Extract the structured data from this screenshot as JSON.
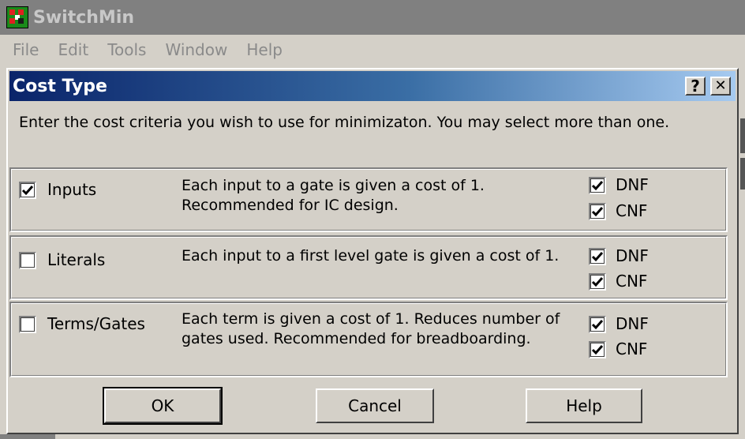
{
  "app": {
    "title": "SwitchMin",
    "menu": [
      "File",
      "Edit",
      "Tools",
      "Window",
      "Help"
    ]
  },
  "dialog": {
    "title": "Cost Type",
    "help_glyph": "?",
    "close_glyph": "✕",
    "instruction": "Enter the cost criteria you wish to use for minimizaton.  You may select more than one.",
    "groups": [
      {
        "label": "Inputs",
        "checked": true,
        "description_lines": [
          "Each input to a gate is given a cost of 1.",
          "Recommended for IC design."
        ],
        "dnf_label": "DNF",
        "dnf_checked": true,
        "cnf_label": "CNF",
        "cnf_checked": true
      },
      {
        "label": "Literals",
        "checked": false,
        "description_lines": [
          "Each input to a first level gate is given a cost of 1."
        ],
        "dnf_label": "DNF",
        "dnf_checked": true,
        "cnf_label": "CNF",
        "cnf_checked": true
      },
      {
        "label": "Terms/Gates",
        "checked": false,
        "description_lines": [
          "Each term is given a cost of 1.  Reduces number of",
          "gates used. Recommended for breadboarding."
        ],
        "dnf_label": "DNF",
        "dnf_checked": true,
        "cnf_label": "CNF",
        "cnf_checked": true
      }
    ],
    "buttons": {
      "ok": "OK",
      "cancel": "Cancel",
      "help": "Help"
    }
  }
}
